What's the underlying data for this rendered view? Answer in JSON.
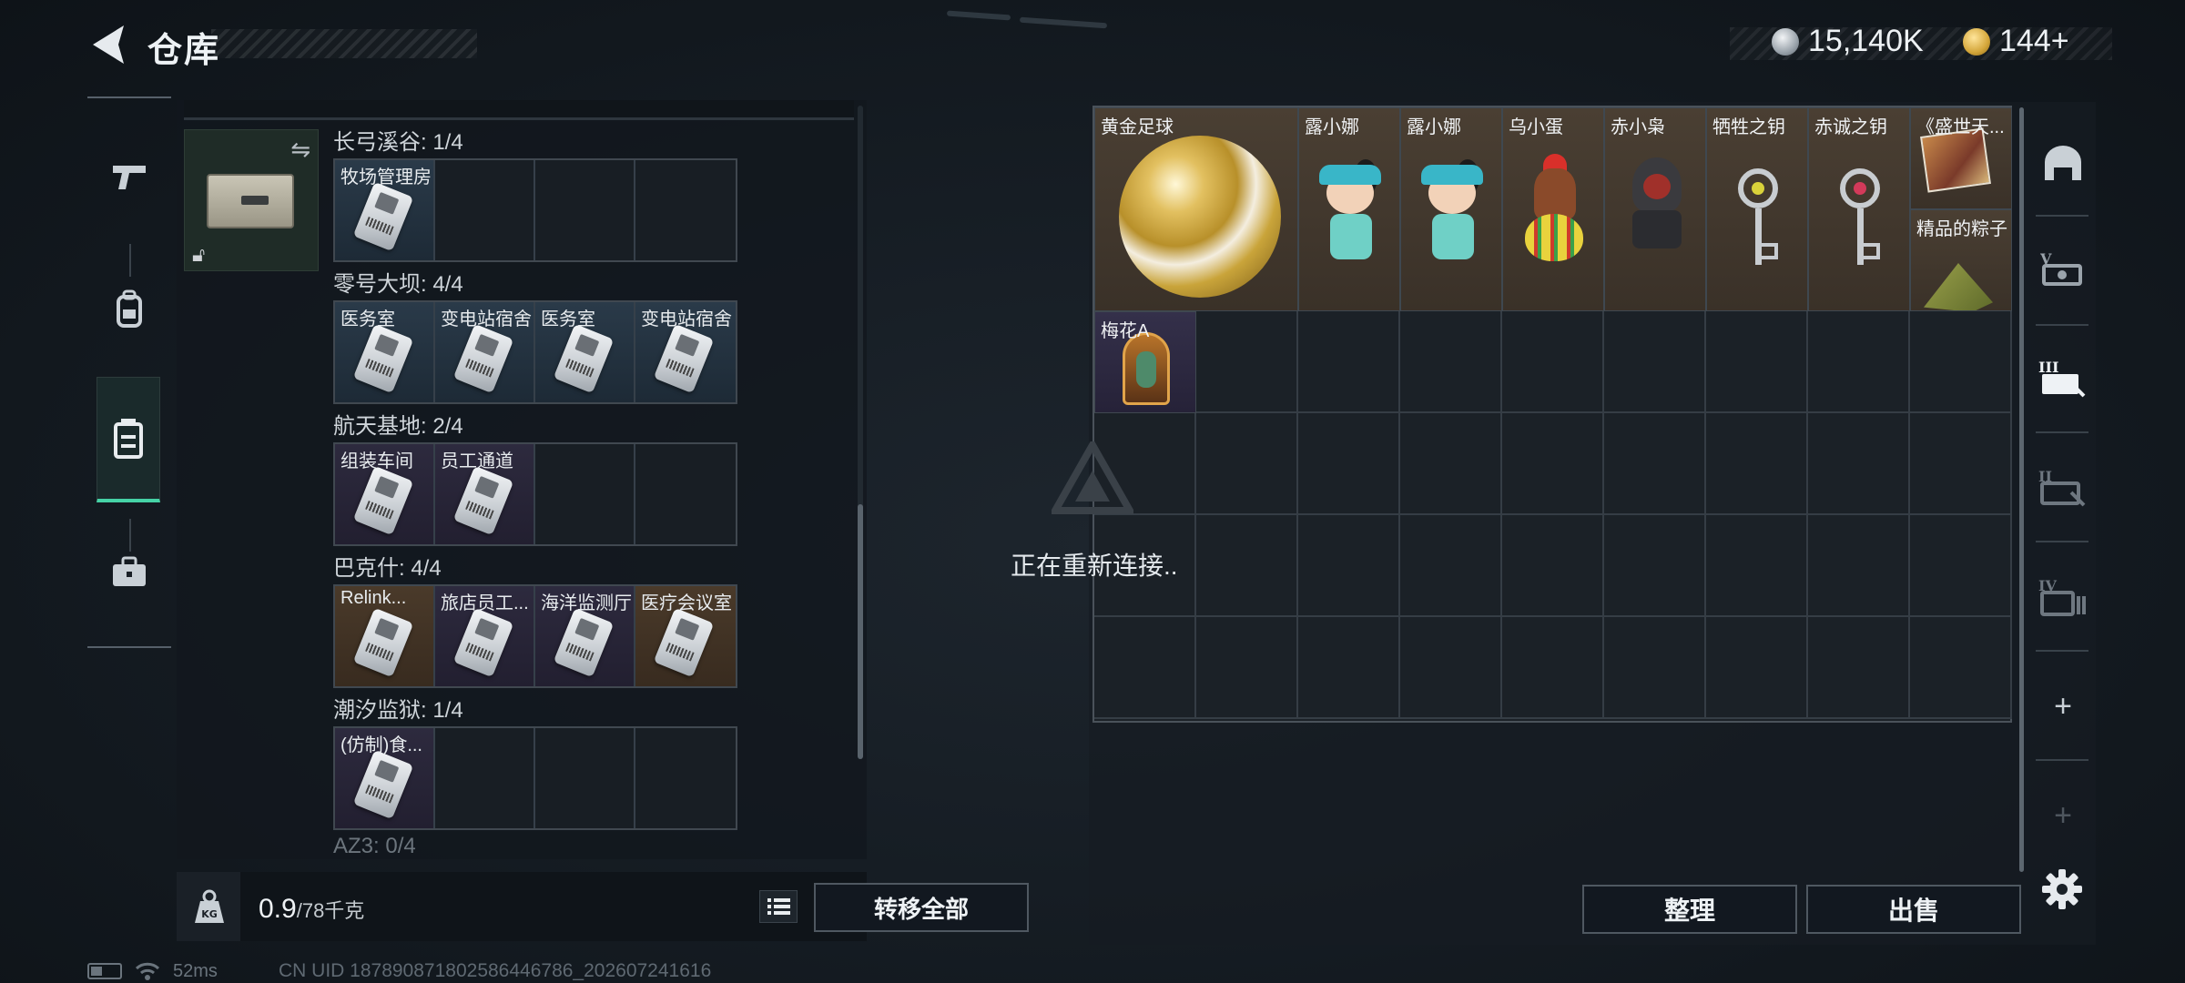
{
  "header": {
    "title": "仓库",
    "currency_silver": "15,140K",
    "currency_gold": "144+"
  },
  "left_nav": {
    "items": [
      "pistol-icon",
      "backpack-icon",
      "container-icon",
      "briefcase-icon"
    ],
    "active_index": 2
  },
  "storage": {
    "sections": [
      {
        "title": "长弓溪谷: 1/4",
        "slots": [
          {
            "label": "牧场管理房",
            "tier": "blue"
          },
          {
            "label": "",
            "tier": "empty"
          },
          {
            "label": "",
            "tier": "empty"
          },
          {
            "label": "",
            "tier": "empty"
          }
        ]
      },
      {
        "title": "零号大坝: 4/4",
        "slots": [
          {
            "label": "医务室",
            "tier": "blue"
          },
          {
            "label": "变电站宿舍",
            "tier": "blue"
          },
          {
            "label": "医务室",
            "tier": "blue"
          },
          {
            "label": "变电站宿舍",
            "tier": "blue"
          }
        ]
      },
      {
        "title": "航天基地: 2/4",
        "slots": [
          {
            "label": "组装车间",
            "tier": "purple"
          },
          {
            "label": "员工通道",
            "tier": "purple"
          },
          {
            "label": "",
            "tier": "empty"
          },
          {
            "label": "",
            "tier": "empty"
          }
        ]
      },
      {
        "title": "巴克什: 4/4",
        "slots": [
          {
            "label": "Relink...",
            "tier": "gold"
          },
          {
            "label": "旅店员工...",
            "tier": "purple"
          },
          {
            "label": "海洋监测厅",
            "tier": "purple"
          },
          {
            "label": "医疗会议室",
            "tier": "gold"
          }
        ]
      },
      {
        "title": "潮汐监狱: 1/4",
        "slots": [
          {
            "label": "(仿制)食...",
            "tier": "purple"
          },
          {
            "label": "",
            "tier": "empty"
          },
          {
            "label": "",
            "tier": "empty"
          },
          {
            "label": "",
            "tier": "empty"
          }
        ]
      },
      {
        "title": "AZ3: 0/4",
        "slots": []
      }
    ]
  },
  "weight": {
    "current": "0.9",
    "capacity": "/78千克"
  },
  "buttons": {
    "transfer_all": "转移全部",
    "organize": "整理",
    "sell": "出售"
  },
  "overlay": {
    "reconnect_text": "正在重新连接.."
  },
  "items": [
    {
      "name": "黄金足球",
      "art": "ball"
    },
    {
      "name": "露小娜",
      "art": "doll"
    },
    {
      "name": "露小娜",
      "art": "doll"
    },
    {
      "name": "乌小蛋",
      "art": "egg"
    },
    {
      "name": "赤小枭",
      "art": "hood"
    },
    {
      "name": "牺牲之钥",
      "art": "key",
      "gem": "#d9d23a"
    },
    {
      "name": "赤诚之钥",
      "art": "key",
      "gem": "#d33a5a"
    },
    {
      "name": "《盛世天...",
      "art": "book"
    },
    {
      "name": "精品的粽子",
      "art": "zongzi"
    },
    {
      "name": "梅花A",
      "art": "card"
    }
  ],
  "right_nav": {
    "items": [
      "safe-house-icon",
      "stash-tab-1-icon",
      "stash-tab-2-icon",
      "stash-tab-3-icon",
      "stash-tab-4-icon",
      "add-tab-icon",
      "add-tab-disabled-icon"
    ]
  },
  "status_bar": {
    "ping": "52ms",
    "uid": "CN UID 187890871802586446786_202607241616"
  }
}
